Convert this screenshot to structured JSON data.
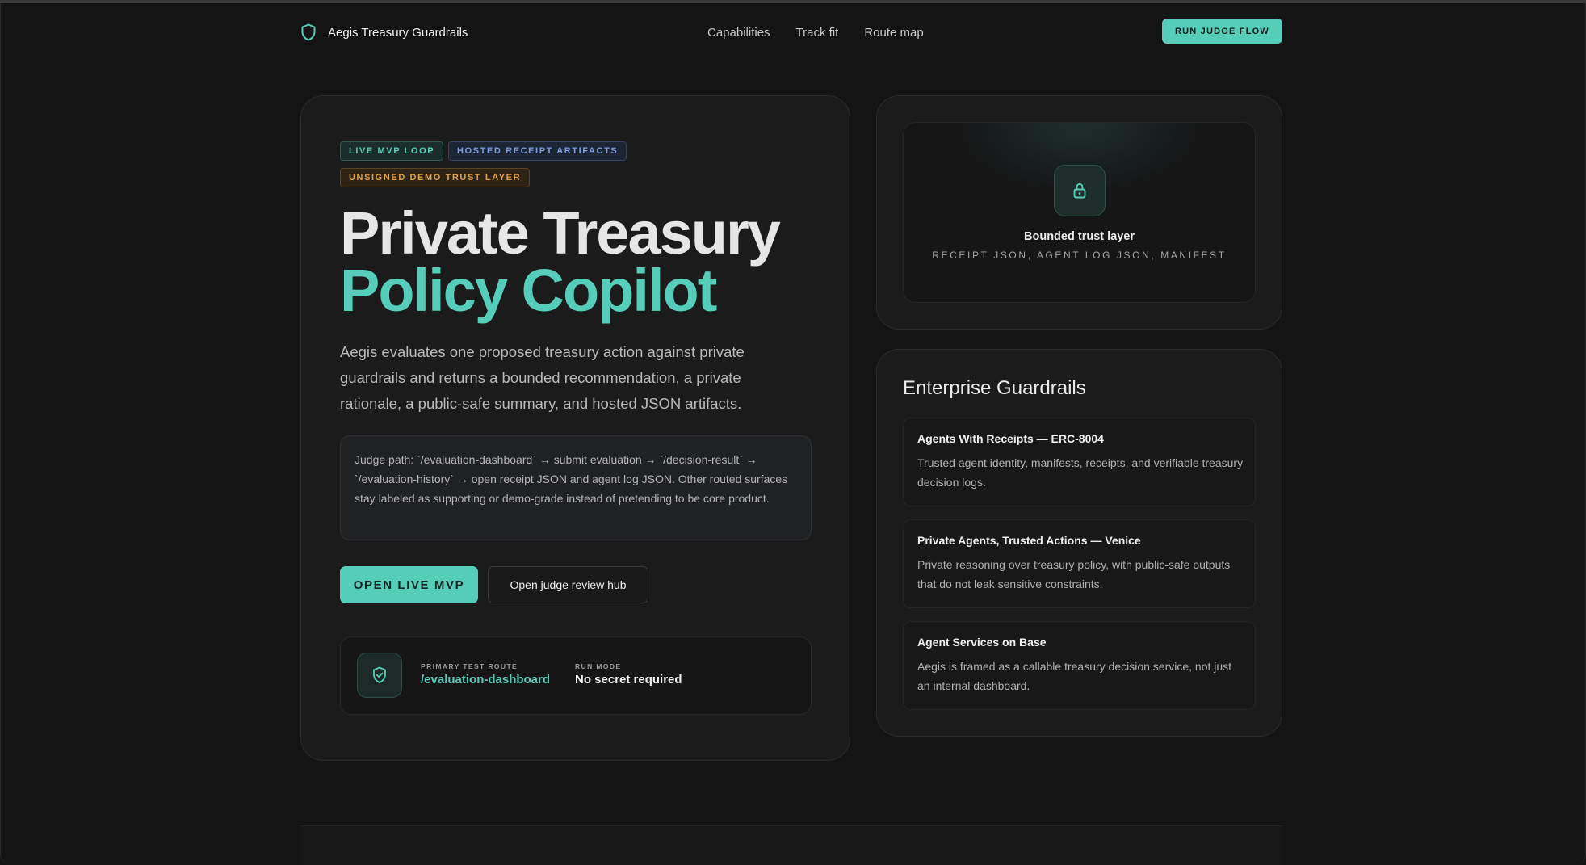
{
  "nav": {
    "brand": "Aegis Treasury Guardrails",
    "links": [
      "Capabilities",
      "Track fit",
      "Route map"
    ],
    "cta": "RUN JUDGE FLOW"
  },
  "hero": {
    "pills": [
      "LIVE MVP LOOP",
      "HOSTED RECEIPT ARTIFACTS",
      "UNSIGNED DEMO TRUST LAYER"
    ],
    "title_line1": "Private Treasury",
    "title_line2": "Policy Copilot",
    "description": "Aegis evaluates one proposed treasury action against private guardrails and returns a bounded recommendation, a private rationale, a public-safe summary, and hosted JSON artifacts.",
    "judge_path": "Judge path: `/evaluation-dashboard` → submit evaluation → `/decision-result` → `/evaluation-history` → open receipt JSON and agent log JSON. Other routed surfaces stay labeled as supporting or demo-grade instead of pretending to be core product.",
    "primary_button": "OPEN LIVE MVP",
    "secondary_button": "Open judge review hub",
    "route": {
      "primary_label": "PRIMARY TEST ROUTE",
      "primary_value": "/evaluation-dashboard",
      "mode_label": "RUN MODE",
      "mode_value": "No secret required"
    }
  },
  "trust": {
    "title": "Bounded trust layer",
    "subtitle": "RECEIPT JSON, AGENT LOG JSON, MANIFEST"
  },
  "guardrails": {
    "title": "Enterprise Guardrails",
    "items": [
      {
        "title": "Agents With Receipts — ERC-8004",
        "desc": "Trusted agent identity, manifests, receipts, and verifiable treasury decision logs."
      },
      {
        "title": "Private Agents, Trusted Actions — Venice",
        "desc": "Private reasoning over treasury policy, with public-safe outputs that do not leak sensitive constraints."
      },
      {
        "title": "Agent Services on Base",
        "desc": "Aegis is framed as a callable treasury decision service, not just an internal dashboard."
      }
    ]
  },
  "colors": {
    "accent": "#56cdb8",
    "background": "#141414",
    "card": "#1b1b1c",
    "pill_blue": "#7c9fe0",
    "pill_orange": "#e0a04a"
  },
  "icons": [
    "shield-icon",
    "lock-icon",
    "shield-check-icon"
  ]
}
